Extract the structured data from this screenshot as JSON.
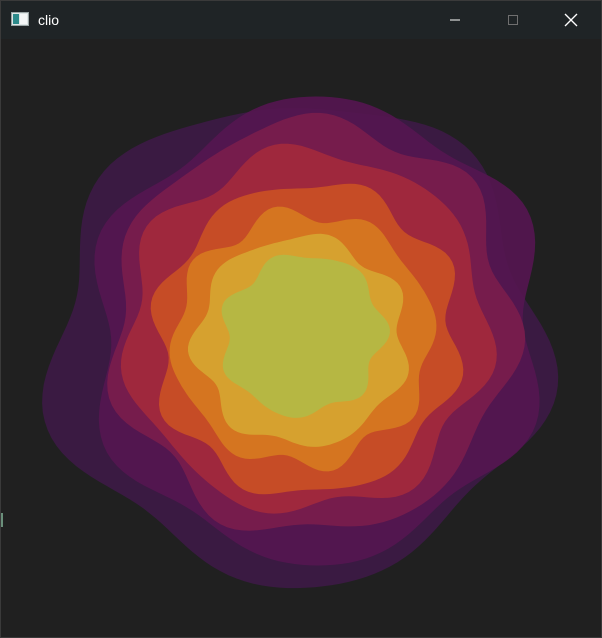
{
  "window": {
    "title": "clio",
    "controls": {
      "minimize_icon": "minimize-icon",
      "maximize_icon": "maximize-icon",
      "close_icon": "close-icon"
    }
  },
  "canvas": {
    "background": "#202020",
    "layer_colors": [
      "#3d1a46",
      "#551650",
      "#7a1d4c",
      "#a3293c",
      "#c94f24",
      "#d6781f",
      "#d6a531",
      "#b3b945"
    ]
  }
}
